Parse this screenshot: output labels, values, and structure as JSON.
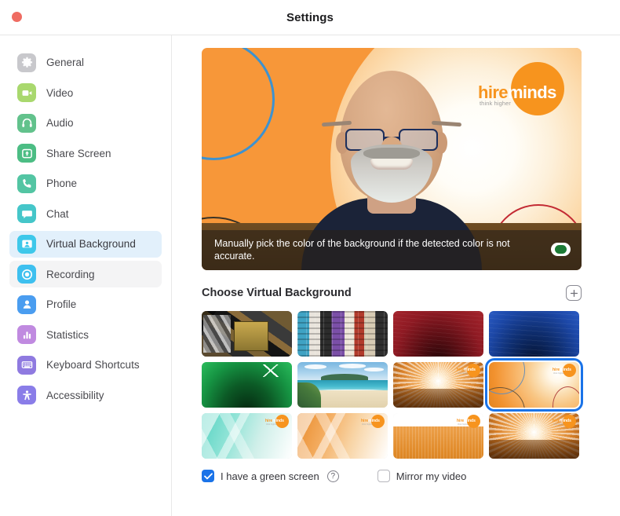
{
  "window": {
    "title": "Settings",
    "close_button": "close"
  },
  "sidebar": {
    "items": [
      {
        "label": "General",
        "icon": "gear-icon",
        "state": "normal",
        "color": "#c8c8cc"
      },
      {
        "label": "Video",
        "icon": "video-camera-icon",
        "state": "normal",
        "color": "#a9d86e"
      },
      {
        "label": "Audio",
        "icon": "headphones-icon",
        "state": "normal",
        "color": "#62c28c"
      },
      {
        "label": "Share Screen",
        "icon": "share-screen-icon",
        "state": "normal",
        "color": "#4cbd84"
      },
      {
        "label": "Phone",
        "icon": "phone-icon",
        "state": "normal",
        "color": "#53c5a3"
      },
      {
        "label": "Chat",
        "icon": "chat-bubble-icon",
        "state": "normal",
        "color": "#45c6c9"
      },
      {
        "label": "Virtual Background",
        "icon": "virtual-background-icon",
        "state": "selected",
        "color": "#3ec8ea"
      },
      {
        "label": "Recording",
        "icon": "recording-icon",
        "state": "hovered",
        "color": "#3ec0ef"
      },
      {
        "label": "Profile",
        "icon": "profile-person-icon",
        "state": "normal",
        "color": "#4a9df0"
      },
      {
        "label": "Statistics",
        "icon": "bar-chart-icon",
        "state": "normal",
        "color": "#c08ae0"
      },
      {
        "label": "Keyboard Shortcuts",
        "icon": "keyboard-icon",
        "state": "normal",
        "color": "#8f7ae0"
      },
      {
        "label": "Accessibility",
        "icon": "accessibility-icon",
        "state": "normal",
        "color": "#8a7de8"
      }
    ]
  },
  "preview": {
    "banner_text": "Manually pick the color of the background if the detected color is not accurate.",
    "swatch_color": "#1c7a35",
    "logo": {
      "word_part_1": "hire",
      "word_part_2": "minds",
      "tagline": "think higher",
      "brand_color": "#f7941e"
    }
  },
  "section": {
    "title": "Choose Virtual Background",
    "add_button_label": "+"
  },
  "backgrounds": [
    {
      "name": "photo-collage",
      "art": "art-collage1",
      "selected": false,
      "logo": false
    },
    {
      "name": "poster-collage",
      "art": "art-collage2",
      "selected": false,
      "logo": false
    },
    {
      "name": "red-gradient",
      "art": "art-red",
      "selected": false,
      "logo": false
    },
    {
      "name": "blue-gradient",
      "art": "art-blue",
      "selected": false,
      "logo": false
    },
    {
      "name": "green-underwater",
      "art": "art-green",
      "selected": false,
      "logo": false
    },
    {
      "name": "beach-shoreline",
      "art": "art-beach",
      "selected": false,
      "logo": false
    },
    {
      "name": "orange-sunburst",
      "art": "art-sunburst",
      "selected": false,
      "logo": true
    },
    {
      "name": "hireminds-orange-circles",
      "art": "art-orange-sel",
      "selected": true,
      "logo": true
    },
    {
      "name": "teal-geometric",
      "art": "art-geo-teal",
      "selected": false,
      "logo": true
    },
    {
      "name": "orange-geometric",
      "art": "art-geo-orange",
      "selected": false,
      "logo": true
    },
    {
      "name": "orange-curve",
      "art": "art-curve",
      "selected": false,
      "logo": true
    },
    {
      "name": "orange-sunburst-2",
      "art": "art-sunburst",
      "selected": false,
      "logo": true
    }
  ],
  "options": {
    "green_screen": {
      "label": "I have a green screen",
      "checked": true,
      "help": "?"
    },
    "mirror_video": {
      "label": "Mirror my video",
      "checked": false
    }
  },
  "mini_logo": {
    "word_part_1": "hire",
    "word_part_2": "minds",
    "tagline": "think higher"
  }
}
